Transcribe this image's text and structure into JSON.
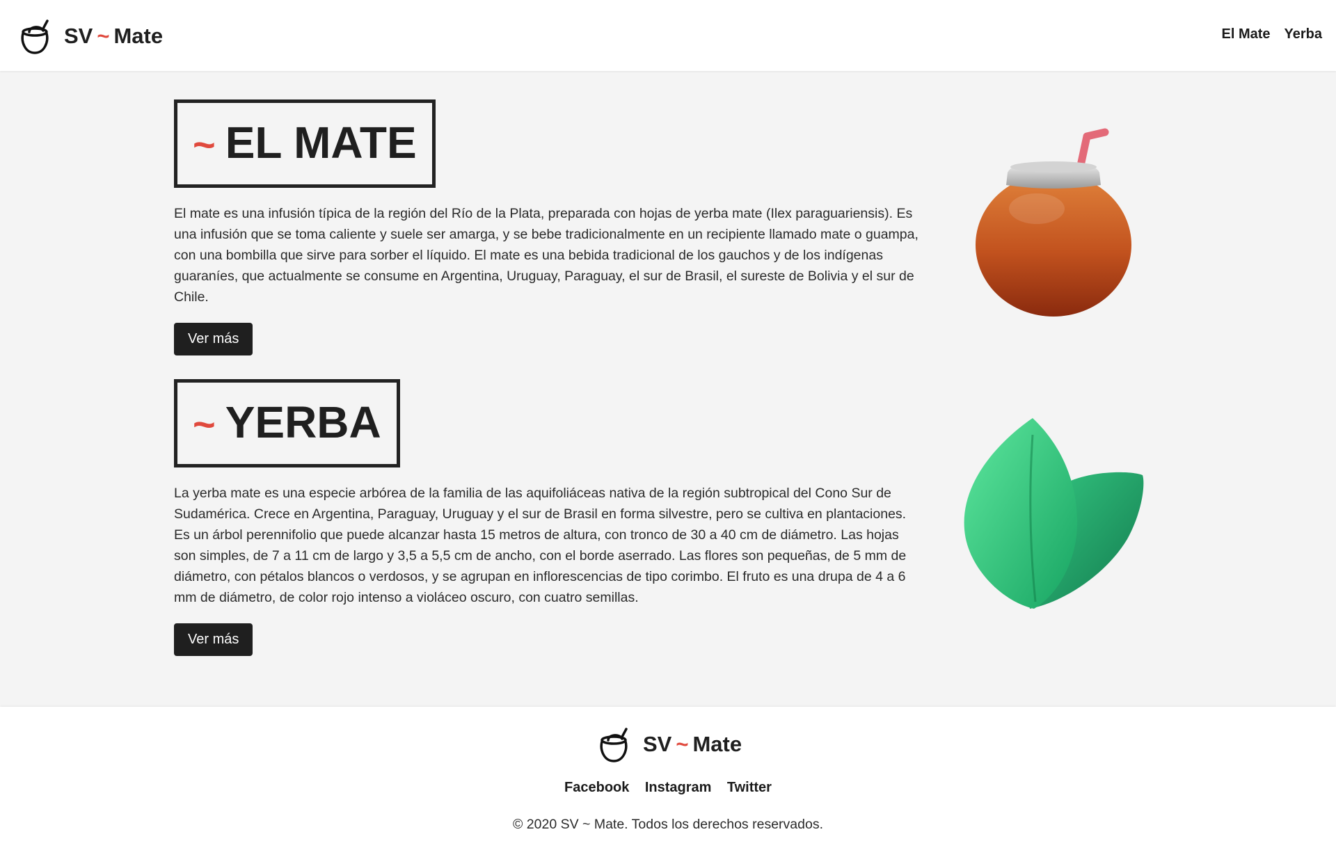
{
  "header": {
    "brand_left": "SV",
    "brand_tilde": "~",
    "brand_right": "Mate",
    "logo_icon": "mate-cup-icon",
    "nav": [
      {
        "label": "El Mate"
      },
      {
        "label": "Yerba"
      }
    ]
  },
  "sections": [
    {
      "tilde": "~",
      "title": "EL MATE",
      "description": "El mate es una infusión típica de la región del Río de la Plata, preparada con hojas de yerba mate (Ilex paraguariensis). Es una infusión que se toma caliente y suele ser amarga, y se bebe tradicionalmente en un recipiente llamado mate o guampa, con una bombilla que sirve para sorber el líquido. El mate es una bebida tradicional de los gauchos y de los indígenas guaraníes, que actualmente se consume en Argentina, Uruguay, Paraguay, el sur de Brasil, el sureste de Bolivia y el sur de Chile.",
      "button_label": "Ver más",
      "image_icon": "mate-gourd-icon"
    },
    {
      "tilde": "~",
      "title": "YERBA",
      "description": "La yerba mate es una especie arbórea de la familia de las aquifoliáceas nativa de la región subtropical del Cono Sur de Sudamérica. Crece en Argentina, Paraguay, Uruguay y el sur de Brasil en forma silvestre, pero se cultiva en plantaciones. Es un árbol perennifolio que puede alcanzar hasta 15 metros de altura, con tronco de 30 a 40 cm de diámetro. Las hojas son simples, de 7 a 11 cm de largo y 3,5 a 5,5 cm de ancho, con el borde aserrado. Las flores son pequeñas, de 5 mm de diámetro, con pétalos blancos o verdosos, y se agrupan en inflorescencias de tipo corimbo. El fruto es una drupa de 4 a 6 mm de diámetro, de color rojo intenso a violáceo oscuro, con cuatro semillas.",
      "button_label": "Ver más",
      "image_icon": "leaves-icon"
    }
  ],
  "footer": {
    "brand_left": "SV",
    "brand_tilde": "~",
    "brand_right": "Mate",
    "links": [
      {
        "label": "Facebook"
      },
      {
        "label": "Instagram"
      },
      {
        "label": "Twitter"
      }
    ],
    "copyright": "© 2020 SV ~ Mate. Todos los derechos reservados."
  },
  "colors": {
    "accent": "#e0493d",
    "background": "#f4f4f4",
    "button": "#1f1f1f"
  }
}
